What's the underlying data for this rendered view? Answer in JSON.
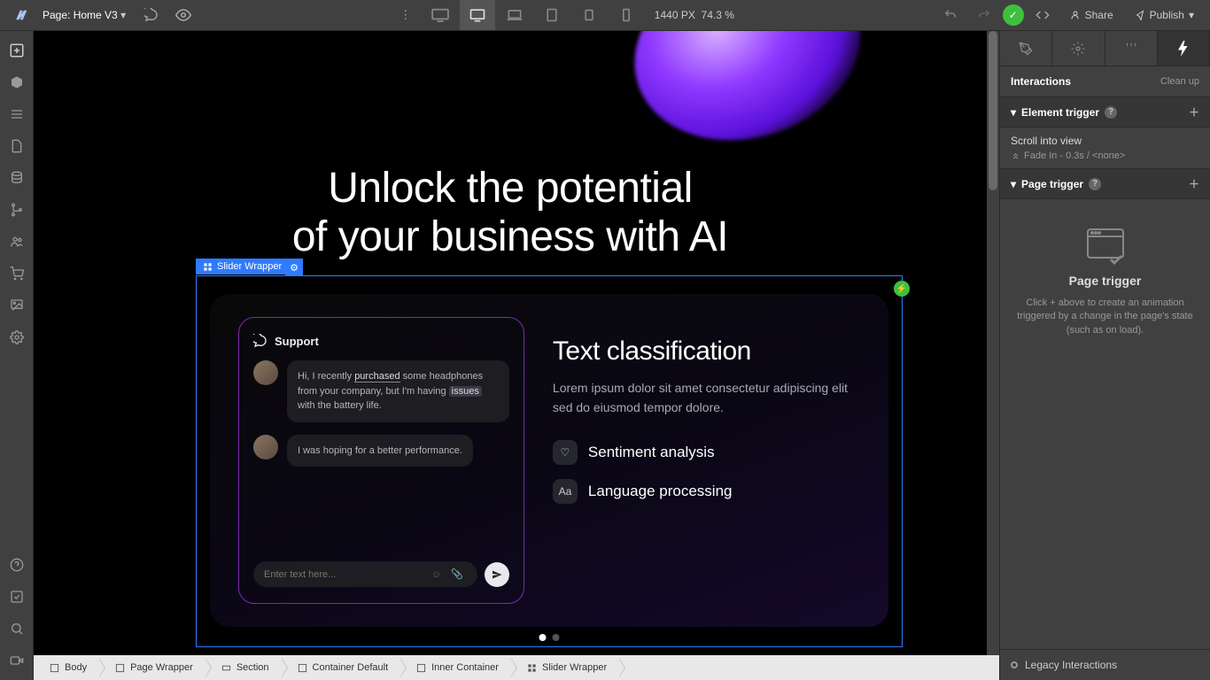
{
  "topbar": {
    "page_prefix": "Page:",
    "page_name": "Home V3",
    "width": "1440",
    "width_unit": "PX",
    "zoom": "74.3 %",
    "share": "Share",
    "publish": "Publish"
  },
  "canvas": {
    "headline_l1": "Unlock the potential",
    "headline_l2": "of your business with AI",
    "selected_label": "Slider Wrapper",
    "chat": {
      "title": "Support",
      "msg1_pre": "Hi, I recently ",
      "msg1_hl1": "purchased",
      "msg1_mid": " some headphones from your company, but I'm having ",
      "msg1_hl2": "issues",
      "msg1_post": " with the battery life.",
      "msg2": "I was hoping for a better performance.",
      "placeholder": "Enter text here..."
    },
    "slide": {
      "title": "Text classification",
      "desc": "Lorem ipsum dolor sit amet consectetur adipiscing elit sed do eiusmod tempor dolore.",
      "feat1": "Sentiment analysis",
      "feat2": "Language processing"
    }
  },
  "breadcrumb": [
    "Body",
    "Page Wrapper",
    "Section",
    "Container Default",
    "Inner Container",
    "Slider Wrapper"
  ],
  "panel": {
    "title": "Interactions",
    "cleanup": "Clean up",
    "elem_trigger": "Element trigger",
    "trigger_name": "Scroll into view",
    "trigger_detail": "Fade In - 0.3s / <none>",
    "page_trigger": "Page trigger",
    "pt_heading": "Page trigger",
    "pt_desc": "Click + above to create an animation triggered by a change in the page's state (such as on load).",
    "legacy": "Legacy Interactions"
  }
}
